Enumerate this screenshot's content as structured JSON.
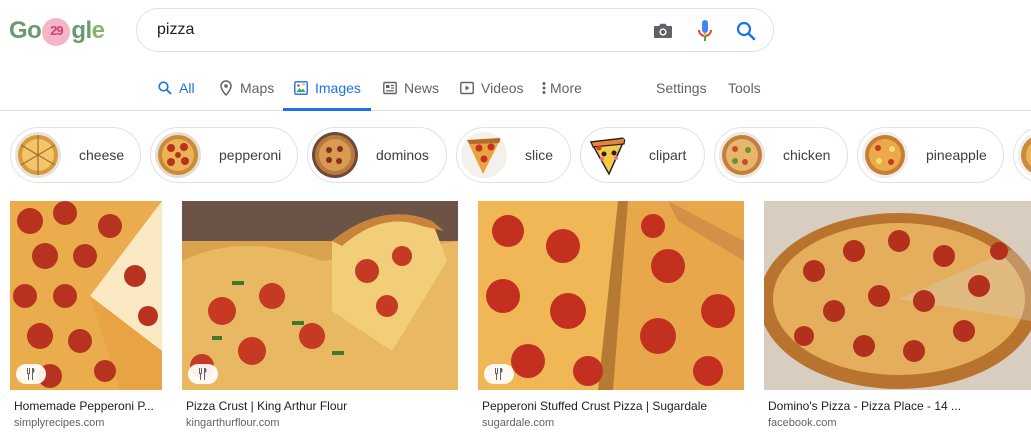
{
  "logo": {
    "g": "Go",
    "doodle": "29",
    "rest_gl": "gl",
    "rest_e": "e"
  },
  "search": {
    "query": "pizza"
  },
  "icons": {
    "camera": "camera-icon",
    "mic": "microphone-icon",
    "search": "search-icon"
  },
  "tabs": [
    {
      "label": "All",
      "icon": "search-icon",
      "active": false
    },
    {
      "label": "Maps",
      "icon": "map-pin-icon",
      "active": false
    },
    {
      "label": "Images",
      "icon": "image-icon",
      "active": true
    },
    {
      "label": "News",
      "icon": "newspaper-icon",
      "active": false
    },
    {
      "label": "Videos",
      "icon": "play-icon",
      "active": false
    },
    {
      "label": "More",
      "icon": "more-vertical-icon",
      "active": false
    }
  ],
  "tools": {
    "settings": "Settings",
    "tools": "Tools"
  },
  "chips": [
    {
      "label": "cheese"
    },
    {
      "label": "pepperoni"
    },
    {
      "label": "dominos"
    },
    {
      "label": "slice"
    },
    {
      "label": "clipart"
    },
    {
      "label": "chicken"
    },
    {
      "label": "pineapple"
    }
  ],
  "results": [
    {
      "title": "Homemade Pepperoni P...",
      "site": "simplyrecipes.com",
      "badge": "recipe-icon"
    },
    {
      "title": "Pizza Crust | King Arthur Flour",
      "site": "kingarthurflour.com",
      "badge": "recipe-icon"
    },
    {
      "title": "Pepperoni Stuffed Crust Pizza | Sugardale",
      "site": "sugardale.com",
      "badge": "recipe-icon"
    },
    {
      "title": "Domino's Pizza - Pizza Place - 14 ...",
      "site": "facebook.com"
    }
  ],
  "colors": {
    "accent": "#1a73e8",
    "border": "#dfe1e5",
    "text_secondary": "#5f6368"
  }
}
